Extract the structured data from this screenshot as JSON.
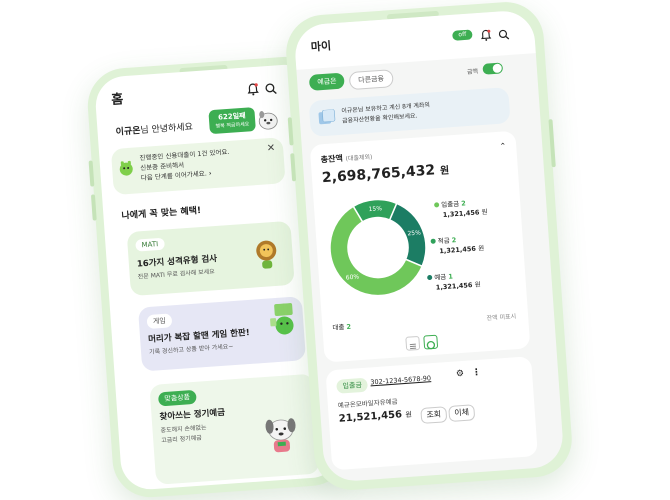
{
  "colors": {
    "brand": "#3dae52",
    "brand_dark": "#1f8a4c",
    "mint": "#e8f6e4",
    "lavender": "#e8e8f6",
    "donut_light": "#6fc75a",
    "donut_mid": "#2fa15a",
    "donut_dark": "#1c7d64"
  },
  "home": {
    "title": "홈",
    "greeting_name": "이규온",
    "greeting_rest": "님 안녕하세요",
    "points_value": "622일째",
    "points_sub": "행복 적금하세요",
    "notice_line1": "진행중인 신용대출이 1건 있어요.",
    "notice_line2": "신분증 준비해서",
    "notice_line3": "다음 단계를 이어가세요.",
    "benefits_title": "나에게 꼭 맞는 혜택!",
    "card1": {
      "badge": "MATI",
      "title": "16가지 성격유형 검사",
      "sub": "전문 MATI 무료 검사해 보세요"
    },
    "card2": {
      "badge": "게임",
      "title": "머리가 복잡 할땐 게임 한판!",
      "sub": "기록 경신하고 상품 받아 가세요~"
    },
    "card3": {
      "badge": "맞춤상품",
      "title": "찾아쓰는 정기예금",
      "sub1": "중도해지 손해없는",
      "sub2": "고금리 정기예금"
    }
  },
  "my": {
    "title": "마이",
    "toggle_label": "off",
    "tabs": [
      "예금은",
      "다른금융"
    ],
    "amount_toggle_label": "금액",
    "banner_line1": "이규온님 보유하고 계신 8개 계좌의",
    "banner_line2": "금융자산현황을 확인해보세요.",
    "total_label": "총잔액",
    "total_sub": "(대출제외)",
    "total_amount": "2,698,765,432",
    "total_unit": "원",
    "chart_labels": [
      "15%",
      "25%",
      "60%"
    ],
    "legend": [
      {
        "name": "입출금",
        "count": "2",
        "amount": "1,321,456",
        "unit": "원"
      },
      {
        "name": "적금",
        "count": "2",
        "amount": "1,321,456",
        "unit": "원"
      },
      {
        "name": "예금",
        "count": "1",
        "amount": "1,321,456",
        "unit": "원"
      }
    ],
    "loan_label": "대출",
    "loan_count": "2",
    "loan_right": "잔액 미표시",
    "account": {
      "badge": "입출금",
      "number": "302-1234-5678-90",
      "name": "예규온모바일자유예금",
      "amount": "21,521,456",
      "unit": "원",
      "btn1": "조회",
      "btn2": "이체"
    }
  },
  "chart_data": {
    "type": "pie",
    "categories": [
      "15%",
      "25%",
      "60%"
    ],
    "values": [
      15,
      25,
      60
    ]
  }
}
